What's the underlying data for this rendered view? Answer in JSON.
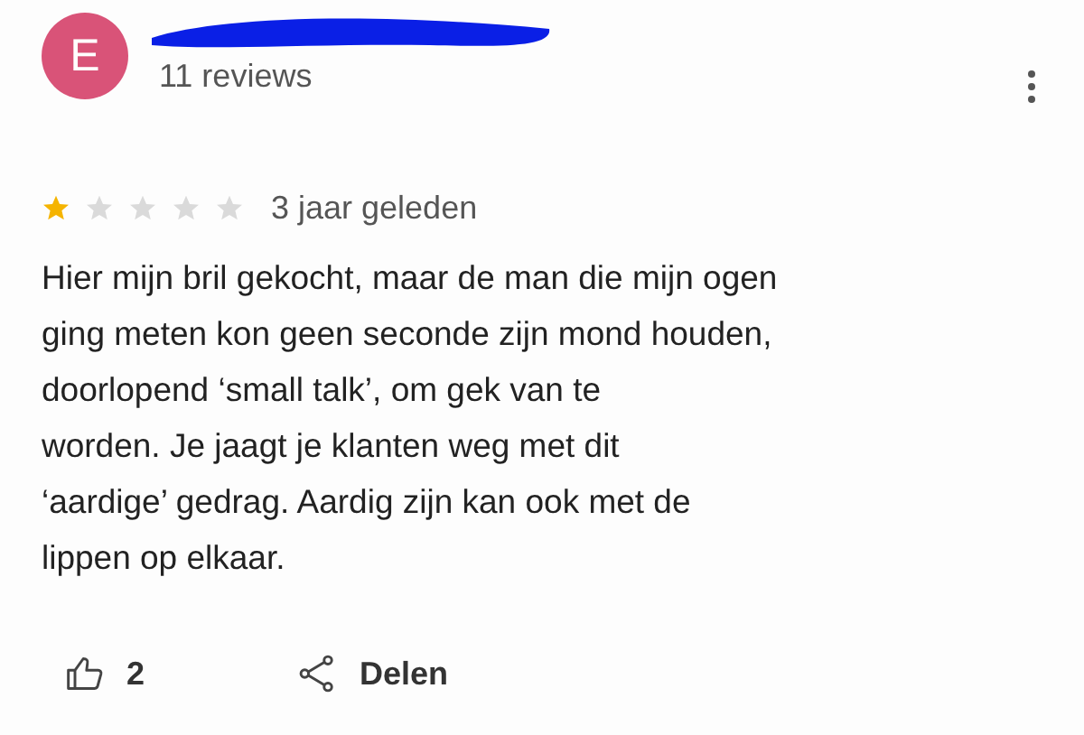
{
  "reviewer": {
    "initial": "E",
    "reviews": "11 reviews"
  },
  "rating": {
    "stars": 1,
    "time": "3 jaar geleden"
  },
  "text_lines": [
    "Hier mijn bril gekocht, maar de man die mijn ogen",
    "ging meten kon geen seconde zijn mond houden,",
    "doorlopend ‘small talk’, om gek van te",
    "worden. Je jaagt je klanten weg met dit",
    "‘aardige’ gedrag. Aardig zijn kan ook met de",
    "lippen op elkaar."
  ],
  "actions": {
    "likes": "2",
    "share": "Delen"
  }
}
